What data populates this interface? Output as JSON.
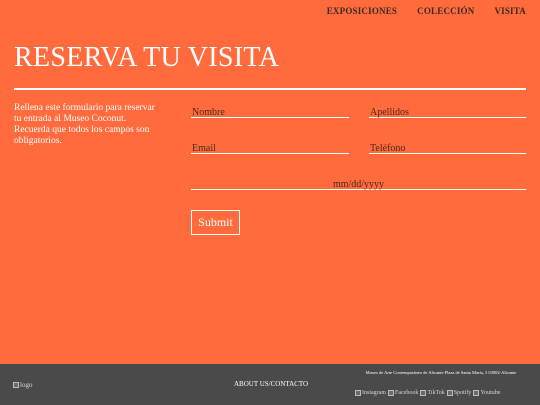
{
  "nav": {
    "items": [
      "EXPOSICIONES",
      "COLECCIÓN",
      "VISITA"
    ]
  },
  "page": {
    "title": "RESERVA TU VISITA",
    "intro": "Rellena este formulario para reservar tu entrada al Museo Coconut. Recuerda que todos los campos son obligatorios."
  },
  "form": {
    "nombre_placeholder": "Nombre",
    "apellidos_placeholder": "Apellidos",
    "email_placeholder": "Email",
    "telefono_placeholder": "Teléfono",
    "date_placeholder": "mm/dd/yyyy",
    "submit_label": "Submit"
  },
  "footer": {
    "logo_alt": "logo",
    "about_link": "ABOUT US/CONTACTO",
    "address": "Museo de Arte Contemporáneo de Alicante Plaza de Santa María, 3 03002-Alicante",
    "social": [
      "Instagram",
      "Facebook",
      "TikTok",
      "Spotify",
      "Youtube"
    ]
  },
  "colors": {
    "background": "#ff6b3d",
    "footer": "#4a4a4a",
    "nav_text": "#3a2a22"
  }
}
